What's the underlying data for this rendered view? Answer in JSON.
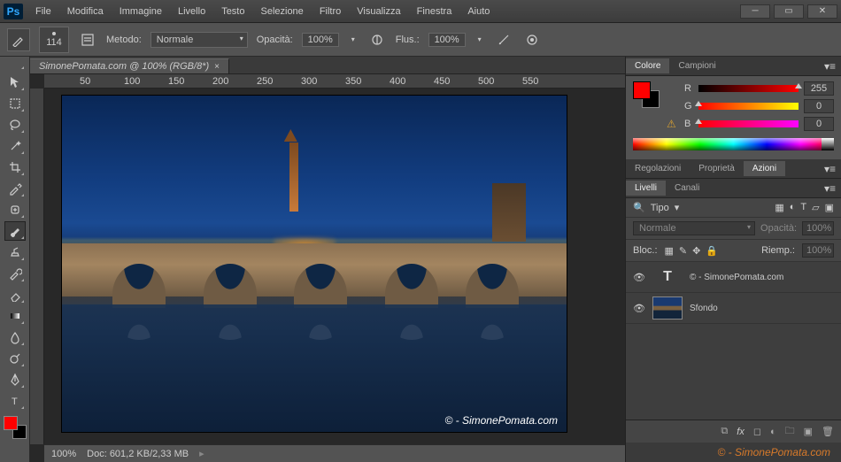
{
  "menubar": [
    "File",
    "Modifica",
    "Immagine",
    "Livello",
    "Testo",
    "Selezione",
    "Filtro",
    "Visualizza",
    "Finestra",
    "Aiuto"
  ],
  "options": {
    "brush_size": "114",
    "metodo_label": "Metodo:",
    "metodo_value": "Normale",
    "opacita_label": "Opacità:",
    "opacita_value": "100%",
    "flusso_label": "Flus.:",
    "flusso_value": "100%"
  },
  "doc_tab": "SimonePomata.com @ 100% (RGB/8*)",
  "ruler": [
    "50",
    "100",
    "150",
    "200",
    "250",
    "300",
    "350",
    "400",
    "450",
    "500",
    "550"
  ],
  "status": {
    "zoom": "100%",
    "doc": "Doc: 601,2 KB/2,33 MB"
  },
  "color_panel": {
    "tab1": "Colore",
    "tab2": "Campioni",
    "r_label": "R",
    "r_value": "255",
    "g_label": "G",
    "g_value": "0",
    "b_label": "B",
    "b_value": "0"
  },
  "adjust_panel": {
    "tab1": "Regolazioni",
    "tab2": "Proprietà",
    "tab3": "Azioni"
  },
  "layers_panel": {
    "tab1": "Livelli",
    "tab2": "Canali",
    "tipo_label": "Tipo",
    "blend": "Normale",
    "opacita_label": "Opacità:",
    "opacita_value": "100%",
    "bloc_label": "Bloc.:",
    "riemp_label": "Riemp.:",
    "riemp_value": "100%",
    "layers": [
      {
        "name": "© - SimonePomata.com",
        "kind": "text"
      },
      {
        "name": "Sfondo",
        "kind": "image"
      }
    ]
  },
  "watermark": "© - SimonePomata.com",
  "site_credit": "© - SimonePomata.com"
}
